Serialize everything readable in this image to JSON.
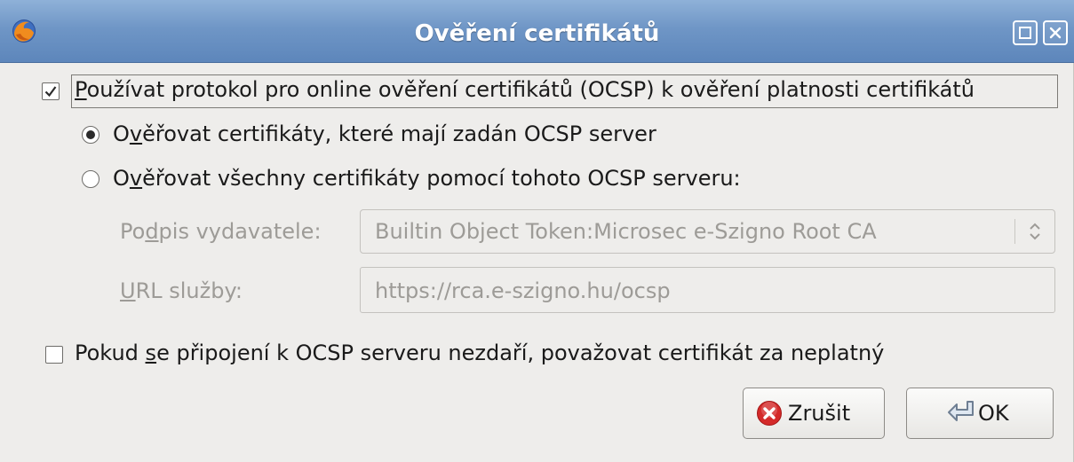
{
  "window": {
    "title": "Ověření certifikátů"
  },
  "icons": {
    "app": "firefox-icon",
    "maximize": "maximize-icon",
    "close": "close-icon",
    "cancel": "red-x-icon",
    "ok": "return-arrow-icon",
    "combo": "up-down-chevron-icon"
  },
  "options": {
    "use_ocsp": {
      "checked": true,
      "label_mnemonic": "P",
      "label_rest": "oužívat protokol pro online ověření certifikátů (OCSP) k ověření platnosti certifikátů"
    },
    "verify_with_server": {
      "selected": true,
      "label_first": "O",
      "label_mnemonic": "v",
      "label_rest": "ěřovat certifikáty, které mají zadán OCSP server"
    },
    "verify_all": {
      "selected": false,
      "label_first": "O",
      "label_mnemonic": "v",
      "label_rest": "ěřovat všechny certifikáty pomocí tohoto OCSP serveru:"
    },
    "treat_invalid": {
      "checked": false,
      "label_first": "Pokud ",
      "label_mnemonic": "s",
      "label_rest": "e připojení k OCSP serveru nezdaří, považovat certifikát za neplatný"
    }
  },
  "fields": {
    "signer": {
      "label_first": "Po",
      "label_mnemonic": "d",
      "label_rest": "pis vydavatele:",
      "value": "Builtin Object Token:Microsec e-Szigno Root CA"
    },
    "service_url": {
      "label_mnemonic": "U",
      "label_rest": "RL služby:",
      "value": "https://rca.e-szigno.hu/ocsp"
    }
  },
  "buttons": {
    "cancel": "Zrušit",
    "ok": "OK"
  },
  "colors": {
    "titlebar": "#6f96c6",
    "dialog_bg": "#eeedeb",
    "disabled_text": "#9d9b97",
    "cancel_icon": "#d42a2a"
  }
}
